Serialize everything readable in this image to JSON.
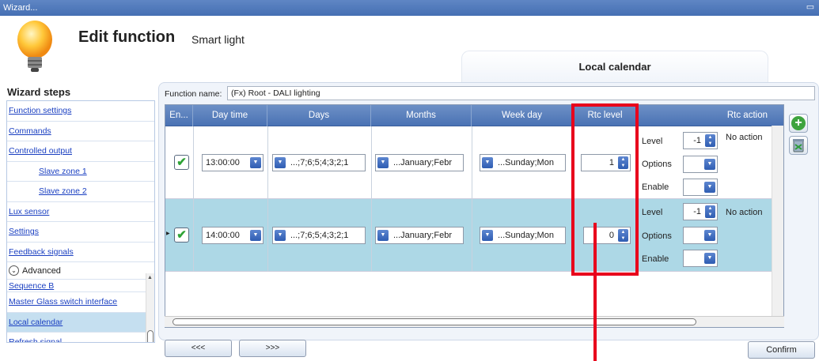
{
  "window": {
    "title": "Wizard..."
  },
  "header": {
    "title": "Edit function",
    "subtitle": "Smart light",
    "tab": "Local calendar"
  },
  "wizard": {
    "title": "Wizard steps",
    "steps": [
      {
        "label": "Function settings"
      },
      {
        "label": "Commands"
      },
      {
        "label": "Controlled output"
      },
      {
        "label": "Slave zone 1"
      },
      {
        "label": "Slave zone 2"
      },
      {
        "label": "Lux sensor"
      },
      {
        "label": "Settings"
      },
      {
        "label": "Feedback signals"
      }
    ],
    "advanced_label": "Advanced",
    "advanced_steps": [
      {
        "label": "Sequence B"
      },
      {
        "label": "Master Glass switch interface"
      },
      {
        "label": "Local calendar"
      },
      {
        "label": "Refresh signal"
      }
    ]
  },
  "function_name": {
    "label": "Function name:",
    "value": "(Fx) Root - DALI lighting"
  },
  "grid": {
    "columns": [
      "En...",
      "Day time",
      "Days",
      "Months",
      "Week day",
      "Rtc level",
      "Rtc action"
    ],
    "rows": [
      {
        "enabled": "✔",
        "day_time": "13:00:00",
        "days": "...;7;6;5;4;3;2;1",
        "months": "...January;Febr",
        "week_day": "...Sunday;Mon",
        "rtc_level": "1",
        "action": {
          "level_label": "Level",
          "level_value": "-1",
          "level_text": "No action",
          "options_label": "Options",
          "enable_label": "Enable"
        }
      },
      {
        "enabled": "✔",
        "day_time": "14:00:00",
        "days": "...;7;6;5;4;3;2;1",
        "months": "...January;Febr",
        "week_day": "...Sunday;Mon",
        "rtc_level": "0",
        "action": {
          "level_label": "Level",
          "level_value": "-1",
          "level_text": "No action",
          "options_label": "Options",
          "enable_label": "Enable"
        }
      }
    ]
  },
  "buttons": {
    "prev": "<<<",
    "next": ">>>",
    "confirm": "Confirm"
  },
  "colors": {
    "titlebar": "#4f76b8",
    "grid_header": "#5a80be",
    "selected_row": "#add8e6",
    "highlight": "#e8001c"
  }
}
